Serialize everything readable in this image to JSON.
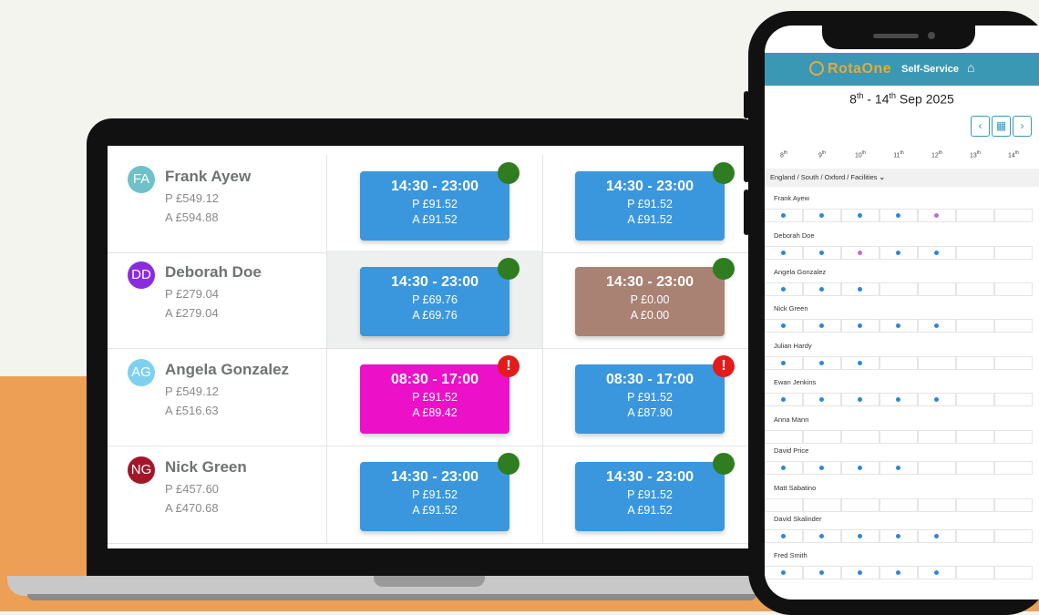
{
  "colors": {
    "shift_blue": "#3a97de",
    "shift_magenta": "#ec10c9",
    "shift_taupe": "#a98274",
    "ok_green": "#2f7d20",
    "warn_red": "#e21b1b",
    "brand_teal": "#3b98b4",
    "brand_orange": "#e8a83a"
  },
  "laptop": {
    "employees": [
      {
        "initials": "FA",
        "avatar_color": "#6ec1c8",
        "name": "Frank Ayew",
        "p": "P £549.12",
        "a": "A £594.88",
        "shifts": [
          {
            "time": "14:30 - 23:00",
            "p": "P £91.52",
            "a": "A £91.52",
            "color": "blue",
            "status": "ok"
          },
          {
            "time": "14:30 - 23:00",
            "p": "P £91.52",
            "a": "A £91.52",
            "color": "blue",
            "status": "ok"
          }
        ]
      },
      {
        "initials": "DD",
        "avatar_color": "#8a2be2",
        "name": "Deborah Doe",
        "p": "P £279.04",
        "a": "A £279.04",
        "shifts": [
          {
            "time": "14:30 - 23:00",
            "p": "P £69.76",
            "a": "A £69.76",
            "color": "blue",
            "status": "ok"
          },
          {
            "time": "14:30 - 23:00",
            "p": "P £0.00",
            "a": "A £0.00",
            "color": "taupe",
            "status": "ok"
          }
        ]
      },
      {
        "initials": "AG",
        "avatar_color": "#7dd0f0",
        "name": "Angela Gonzalez",
        "p": "P £549.12",
        "a": "A £516.63",
        "shifts": [
          {
            "time": "08:30 - 17:00",
            "p": "P £91.52",
            "a": "A £89.42",
            "color": "magenta",
            "status": "warn"
          },
          {
            "time": "08:30 - 17:00",
            "p": "P £91.52",
            "a": "A £87.90",
            "color": "blue",
            "status": "warn"
          }
        ]
      },
      {
        "initials": "NG",
        "avatar_color": "#a3162a",
        "name": "Nick Green",
        "p": "P £457.60",
        "a": "A £470.68",
        "shifts": [
          {
            "time": "14:30 - 23:00",
            "p": "P £91.52",
            "a": "A £91.52",
            "color": "blue",
            "status": "ok"
          },
          {
            "time": "14:30 - 23:00",
            "p": "P £91.52",
            "a": "A £91.52",
            "color": "blue",
            "status": "ok"
          }
        ]
      }
    ]
  },
  "phone": {
    "brand": "RotaOne",
    "self_service_label": "Self-Service",
    "home_icon": "home-icon",
    "week": {
      "start_day": "8",
      "start_suffix": "th",
      "dash": " - ",
      "end_day": "14",
      "end_suffix": "th",
      "rest": " Sep 2025"
    },
    "days": [
      {
        "d": "8",
        "s": "th"
      },
      {
        "d": "9",
        "s": "th"
      },
      {
        "d": "10",
        "s": "th"
      },
      {
        "d": "11",
        "s": "th"
      },
      {
        "d": "12",
        "s": "th"
      },
      {
        "d": "13",
        "s": "th"
      },
      {
        "d": "14",
        "s": "th"
      }
    ],
    "filter": "England / South / Oxford / Facilities",
    "employees": [
      {
        "name": "Frank Ayew",
        "dots": [
          "b",
          "b",
          "b",
          "b",
          "p",
          "",
          ""
        ]
      },
      {
        "name": "Deborah Doe",
        "dots": [
          "b",
          "b",
          "p",
          "b",
          "b",
          "",
          ""
        ]
      },
      {
        "name": "Angela Gonzalez",
        "dots": [
          "b",
          "b",
          "b",
          "",
          "",
          "",
          ""
        ]
      },
      {
        "name": "Nick Green",
        "dots": [
          "b",
          "b",
          "b",
          "b",
          "b",
          "",
          ""
        ]
      },
      {
        "name": "Julian Hardy",
        "dots": [
          "b",
          "b",
          "b",
          "",
          "",
          "",
          ""
        ]
      },
      {
        "name": "Ewan Jenkins",
        "dots": [
          "b",
          "b",
          "b",
          "b",
          "b",
          "",
          ""
        ]
      },
      {
        "name": "Anna Mann",
        "dots": [
          "",
          "",
          "",
          "",
          "",
          "",
          ""
        ]
      },
      {
        "name": "David Price",
        "dots": [
          "b",
          "b",
          "b",
          "b",
          "",
          "",
          ""
        ]
      },
      {
        "name": "Matt Sabatino",
        "dots": [
          "",
          "",
          "",
          "",
          "",
          "",
          ""
        ]
      },
      {
        "name": "David Skalinder",
        "dots": [
          "b",
          "b",
          "b",
          "b",
          "b",
          "",
          ""
        ]
      },
      {
        "name": "Fred Smith",
        "dots": [
          "b",
          "b",
          "b",
          "b",
          "b",
          "",
          ""
        ]
      }
    ]
  }
}
